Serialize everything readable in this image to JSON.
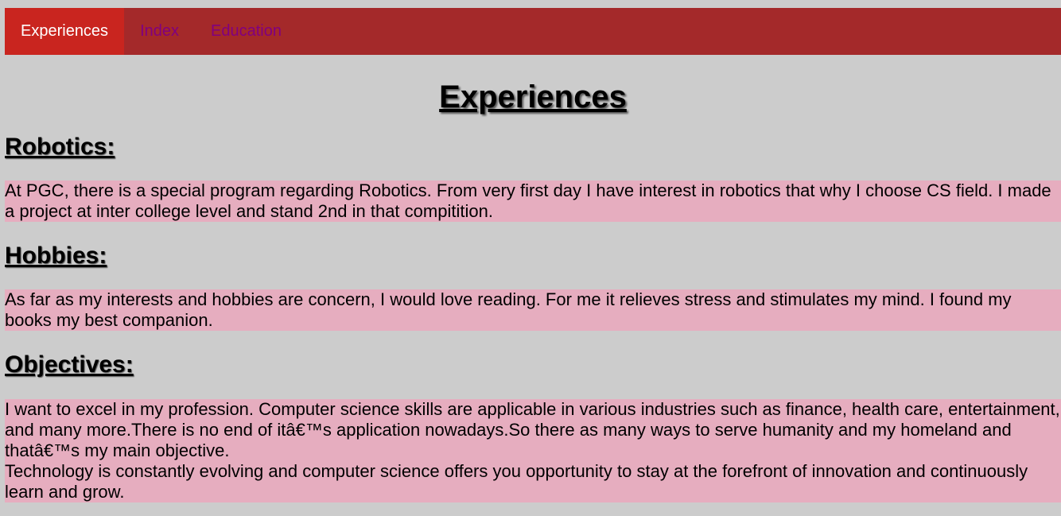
{
  "nav": {
    "items": [
      {
        "label": "Experiences",
        "active": true
      },
      {
        "label": "Index",
        "active": false
      },
      {
        "label": "Education",
        "active": false
      }
    ]
  },
  "page": {
    "title": "Experiences"
  },
  "sections": {
    "robotics": {
      "heading": "Robotics:",
      "text": "At PGC, there is a special program regarding Robotics. From very first day I have interest in robotics that why I choose CS field. I made a project at inter college level and stand 2nd in that compitition."
    },
    "hobbies": {
      "heading": "Hobbies:",
      "text": "As far as my interests and hobbies are concern, I would love reading. For me it relieves stress and stimulates my mind. I found my books my best companion."
    },
    "objectives": {
      "heading": "Objectives:",
      "line1": "I want to excel in my profession. Computer science skills are applicable in various industries such as finance, health care, entertainment, and many more.There is no end of itâ€™s application nowadays.So there as many ways to serve humanity and my homeland and thatâ€™s my main objective.",
      "line2": "Technology is constantly evolving and computer science offers you opportunity to stay at the forefront of innovation and continuously learn and grow."
    }
  },
  "colors": {
    "nav_background": "#a4292a",
    "nav_active": "#c9251f",
    "nav_link": "#800080",
    "page_background": "#cccccc",
    "paragraph_background": "#e6adbf"
  }
}
